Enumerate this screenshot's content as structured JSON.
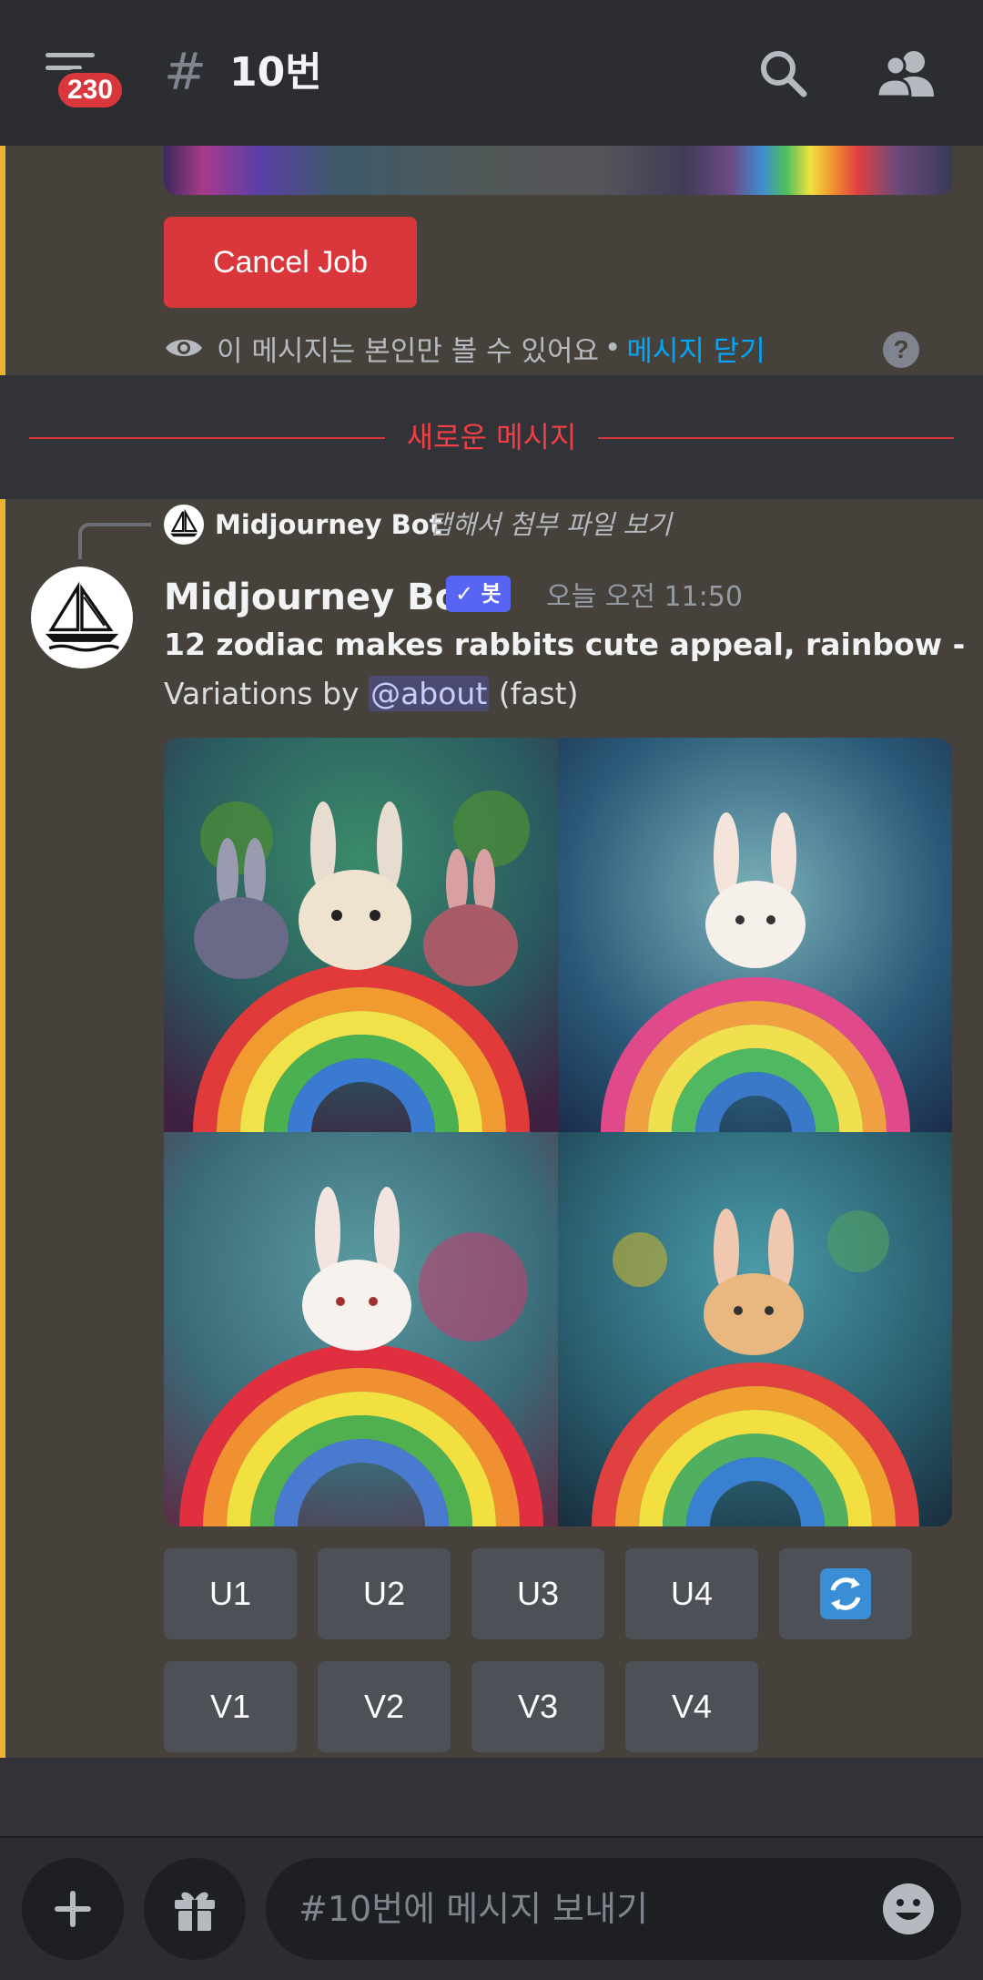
{
  "header": {
    "unread_count": "230",
    "channel_hash": "#",
    "channel_name": "10번"
  },
  "ephemeral": {
    "cancel_label": "Cancel Job",
    "visibility_note": "이 메시지는 본인만 볼 수 있어요",
    "separator": "•",
    "dismiss_label": "메시지 닫기",
    "help_glyph": "?"
  },
  "divider": {
    "label": "새로운 메시지"
  },
  "message": {
    "reply_author": "Midjourney Bot",
    "reply_text": "탭해서 첨부 파일 보기",
    "author": "Midjourney Bot",
    "bot_tag": "✓ 봇",
    "timestamp": "오늘 오전 11:50",
    "prompt": "12 zodiac makes rabbits cute appeal, rainbow -",
    "variations_prefix": "Variations by ",
    "mention": "@about",
    "speed": " (fast)"
  },
  "actions": {
    "upscale": [
      "U1",
      "U2",
      "U3",
      "U4"
    ],
    "variation": [
      "V1",
      "V2",
      "V3",
      "V4"
    ],
    "reroll_icon": "refresh-icon"
  },
  "composer": {
    "placeholder": "#10번에 메시지 보내기",
    "add_icon": "plus-icon",
    "gift_icon": "gift-icon",
    "emoji_icon": "emoji-icon"
  },
  "colors": {
    "ephemeral_bg": "#46413a",
    "accent_bar": "#f0b232",
    "danger": "#da373c",
    "link": "#00a8fc",
    "blurple": "#5865f2",
    "button": "#4e5058"
  }
}
